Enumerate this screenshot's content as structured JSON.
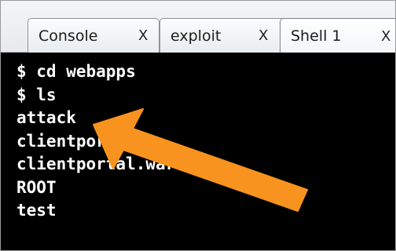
{
  "tabs": [
    {
      "label": "Console",
      "close": "X"
    },
    {
      "label": "exploit",
      "close": "X"
    },
    {
      "label": "Shell 1",
      "close": "X",
      "active": true
    }
  ],
  "terminal": {
    "lines": [
      "$ cd webapps",
      "$ ls",
      "attack",
      "clientportal",
      "clientportal.war",
      "ROOT",
      "test"
    ]
  },
  "annotation": {
    "arrow_color": "#f7931e",
    "icon": "arrow-pointing-left-up"
  }
}
